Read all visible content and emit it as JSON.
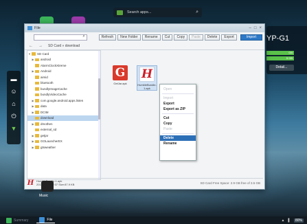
{
  "search": {
    "placeholder": "Search apps..."
  },
  "widget": {
    "device_name": "YP-G1",
    "bar1": "GB",
    "bar2": "5 GB",
    "detail_button": "Detail..."
  },
  "window": {
    "title": "File",
    "controls": [
      "–",
      "□",
      "×"
    ],
    "toolbar": [
      "Refresh",
      "New Folder",
      "Rename",
      "Cut",
      "Copy",
      "Paste",
      "Delete",
      "Export"
    ],
    "import_button": "Import",
    "breadcrumb": "SD Card » download"
  },
  "tree": {
    "items": [
      {
        "label": "SD Card",
        "arrow": "▼",
        "sel": false
      },
      {
        "label": "android",
        "arrow": "▶",
        "sel": false
      },
      {
        "label": "AlarmClockXtreme",
        "arrow": "",
        "sel": false
      },
      {
        "label": "Android",
        "arrow": "▶",
        "sel": false
      },
      {
        "label": "aimid",
        "arrow": "",
        "sel": false
      },
      {
        "label": "bluetooth",
        "arrow": "",
        "sel": false
      },
      {
        "label": "bundlyImageCache",
        "arrow": "",
        "sel": false
      },
      {
        "label": "bundlyVideoCache",
        "arrow": "",
        "sel": false
      },
      {
        "label": "com.google.android.apps.listen",
        "arrow": "▶",
        "sel": false
      },
      {
        "label": "data",
        "arrow": "▶",
        "sel": false
      },
      {
        "label": "DCIM",
        "arrow": "▶",
        "sel": false
      },
      {
        "label": "download",
        "arrow": "",
        "sel": true
      },
      {
        "label": "dmothen",
        "arrow": "▶",
        "sel": false
      },
      {
        "label": "external_sd",
        "arrow": "",
        "sel": false
      },
      {
        "label": "getjar",
        "arrow": "▶",
        "sel": false
      },
      {
        "label": "GOLauncherEX",
        "arrow": "▶",
        "sel": false
      },
      {
        "label": "gtsweather",
        "arrow": "▶",
        "sel": false
      }
    ]
  },
  "files": [
    {
      "name": "GetJar.apk",
      "glyph": "G"
    },
    {
      "name": "HumbleBundle-1.apk",
      "glyph": "H"
    }
  ],
  "context_menu": [
    {
      "label": "Open",
      "state": "dis"
    },
    {
      "label": "Import",
      "state": "dis"
    },
    {
      "label": "Export",
      "state": ""
    },
    {
      "label": "Export as ZIP",
      "state": ""
    },
    {
      "label": "Cut",
      "state": ""
    },
    {
      "label": "Copy",
      "state": ""
    },
    {
      "label": "Paste",
      "state": "dis"
    },
    {
      "label": "Delete",
      "state": "hl"
    },
    {
      "label": "Rename",
      "state": ""
    }
  ],
  "status": {
    "filename": "HumbleBundle-1.apk",
    "meta": "2012/02/13 02:37   Size:87.9 KB",
    "free_space": "SD Card Free Space: 2.9 GB free of 3.5 GB"
  },
  "music_label": "Music",
  "taskbar": {
    "summary": "Summary",
    "file": "File",
    "battery": "80%"
  }
}
